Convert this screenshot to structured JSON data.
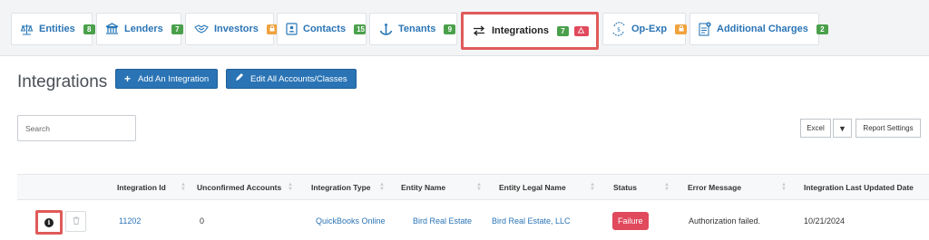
{
  "tabs": [
    {
      "label": "Entities",
      "badge": "8",
      "badge_color": "green",
      "icon": "scale-icon"
    },
    {
      "label": "Lenders",
      "badge": "7",
      "badge_color": "green",
      "icon": "bank-icon"
    },
    {
      "label": "Investors",
      "badge": "",
      "badge_color": "orange",
      "icon": "handshake-icon"
    },
    {
      "label": "Contacts",
      "badge": "15",
      "badge_color": "green",
      "icon": "contact-card-icon"
    },
    {
      "label": "Tenants",
      "badge": "9",
      "badge_color": "green",
      "icon": "anchor-icon"
    },
    {
      "label": "Integrations",
      "badge": "7",
      "badge_color": "green",
      "alert_badge": "",
      "icon": "exchange-arrows-icon",
      "active": true
    },
    {
      "label": "Op-Exp",
      "badge": "",
      "badge_color": "orange",
      "icon": "money-cycle-icon"
    },
    {
      "label": "Additional Charges",
      "badge": "2",
      "badge_color": "green",
      "icon": "document-plus-icon"
    }
  ],
  "header": {
    "title": "Integrations",
    "add_button": "Add An Integration",
    "edit_button": "Edit All Accounts/Classes"
  },
  "search": {
    "placeholder": "Search",
    "value": ""
  },
  "toolbar": {
    "excel": "Excel",
    "caret": "▼",
    "report_settings": "Report Settings"
  },
  "table": {
    "columns": [
      "Integration Id",
      "Unconfirmed Accounts",
      "Integration Type",
      "Entity Name",
      "Entity Legal Name",
      "Status",
      "Error Message",
      "Integration Last Updated Date"
    ],
    "rows": [
      {
        "integration_id": "11202",
        "unconfirmed_accounts": "0",
        "integration_type": "QuickBooks Online",
        "entity_name": "Bird Real Estate",
        "entity_legal_name": "Bird Real Estate, LLC",
        "status": "Failure",
        "error_message": "Authorization failed.",
        "last_updated": "10/21/2024"
      }
    ]
  },
  "colors": {
    "primary": "#2a74b5",
    "green_badge": "#4aa04a",
    "orange_badge": "#f0a23b",
    "failure": "#e04a5c",
    "highlight_border": "#e05a5a"
  }
}
